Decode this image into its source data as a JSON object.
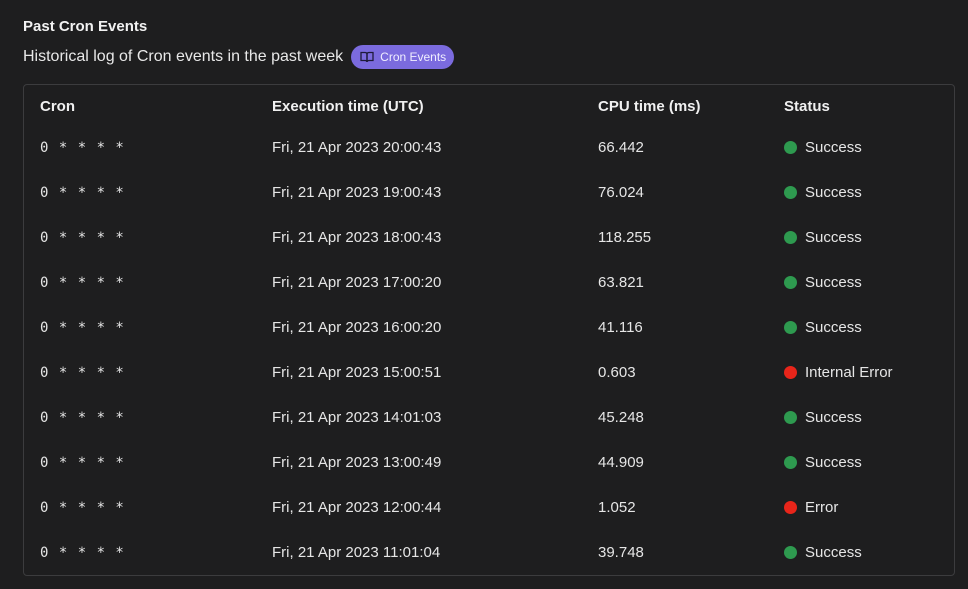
{
  "header": {
    "title": "Past Cron Events",
    "subtitle": "Historical log of Cron events in the past week",
    "badge_label": "Cron Events",
    "badge_icon": "book-icon"
  },
  "table": {
    "columns": [
      "Cron",
      "Execution time (UTC)",
      "CPU time (ms)",
      "Status"
    ],
    "rows": [
      {
        "cron": "0 * * * *",
        "time": "Fri, 21 Apr 2023 20:00:43",
        "cpu": "66.442",
        "status": "Success"
      },
      {
        "cron": "0 * * * *",
        "time": "Fri, 21 Apr 2023 19:00:43",
        "cpu": "76.024",
        "status": "Success"
      },
      {
        "cron": "0 * * * *",
        "time": "Fri, 21 Apr 2023 18:00:43",
        "cpu": "118.255",
        "status": "Success"
      },
      {
        "cron": "0 * * * *",
        "time": "Fri, 21 Apr 2023 17:00:20",
        "cpu": "63.821",
        "status": "Success"
      },
      {
        "cron": "0 * * * *",
        "time": "Fri, 21 Apr 2023 16:00:20",
        "cpu": "41.116",
        "status": "Success"
      },
      {
        "cron": "0 * * * *",
        "time": "Fri, 21 Apr 2023 15:00:51",
        "cpu": "0.603",
        "status": "Internal Error"
      },
      {
        "cron": "0 * * * *",
        "time": "Fri, 21 Apr 2023 14:01:03",
        "cpu": "45.248",
        "status": "Success"
      },
      {
        "cron": "0 * * * *",
        "time": "Fri, 21 Apr 2023 13:00:49",
        "cpu": "44.909",
        "status": "Success"
      },
      {
        "cron": "0 * * * *",
        "time": "Fri, 21 Apr 2023 12:00:44",
        "cpu": "1.052",
        "status": "Error"
      },
      {
        "cron": "0 * * * *",
        "time": "Fri, 21 Apr 2023 11:01:04",
        "cpu": "39.748",
        "status": "Success"
      }
    ]
  },
  "colors": {
    "success": "#2e9a4f",
    "error": "#e8251a",
    "badge": "#7b6bde"
  }
}
